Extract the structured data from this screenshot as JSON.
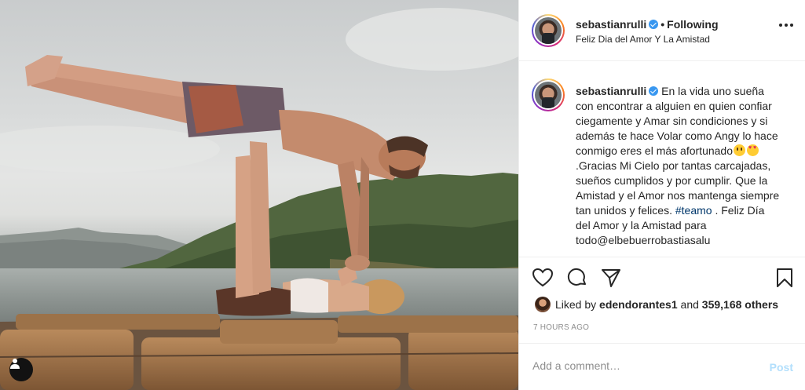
{
  "post_header": {
    "username": "sebastianrulli",
    "separator": "•",
    "follow_status": "Following",
    "location": "Feliz Dia del Amor Y La Amistad"
  },
  "caption": {
    "username": "sebastianrulli",
    "text_1": "En la vida uno sueña con encontrar a alguien en quien confiar ciegamente y Amar sin condiciones y si además te hace Volar como Angy lo hace conmigo eres el más afortunado",
    "text_2": ".Gracias Mi Cielo por tantas carcajadas, sueños cumplidos y por cumplir. Que la Amistad y el Amor nos mantenga siempre tan unidos y felices.",
    "hashtag": "#teamo",
    "text_3": ". Feliz Día del Amor y la Amistad para",
    "text_4": "todo@elbebuerrobastiasalu"
  },
  "icons": {
    "like": "heart-icon",
    "comment": "comment-icon",
    "share": "share-icon",
    "save": "bookmark-icon",
    "more": "more-options-icon",
    "user_tag": "user-tag-icon"
  },
  "likes": {
    "prefix": "Liked by",
    "liker": "edendorantes1",
    "and": "and",
    "count": "359,168 others"
  },
  "timestamp": "7 HOURS AGO",
  "comment_box": {
    "placeholder": "Add a comment…",
    "post_label": "Post"
  },
  "colors": {
    "verified": "#3897f0",
    "post_disabled": "#b2dffc",
    "hashtag": "#00376b",
    "muted": "#8e8e8e"
  }
}
